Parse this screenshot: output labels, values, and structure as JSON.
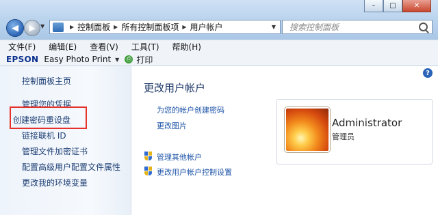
{
  "window": {
    "minimize_glyph": "–",
    "maximize_glyph": "□",
    "close_glyph": "✕"
  },
  "address_bar": {
    "breadcrumbs": [
      "控制面板",
      "所有控制面板项",
      "用户帐户"
    ],
    "search_placeholder": "搜索控制面板"
  },
  "menu": [
    "文件(F)",
    "编辑(E)",
    "查看(V)",
    "工具(T)",
    "帮助(H)"
  ],
  "epson_toolbar": {
    "brand": "EPSON",
    "app": "Easy Photo Print",
    "print": "打印"
  },
  "sidebar": {
    "items": [
      {
        "label": "控制面板主页"
      },
      {
        "label": "管理您的凭据"
      },
      {
        "label": "创建密码重设盘",
        "highlighted": true
      },
      {
        "label": "链接联机 ID"
      },
      {
        "label": "管理文件加密证书"
      },
      {
        "label": "配置高级用户配置文件属性"
      },
      {
        "label": "更改我的环境变量"
      }
    ]
  },
  "main": {
    "title": "更改用户帐户",
    "links": [
      "为您的帐户创建密码",
      "更改图片"
    ],
    "admin_links": [
      "管理其他帐户",
      "更改用户帐户控制设置"
    ]
  },
  "account": {
    "name": "Administrator",
    "role": "管理员"
  },
  "colors": {
    "highlight_border": "#e5322b",
    "link": "#1e54a8",
    "epson_brand": "#0a2f8c"
  },
  "icons": [
    "back-arrow-icon",
    "forward-arrow-icon",
    "folder-icon",
    "refresh-icon",
    "search-icon",
    "print-icon",
    "help-icon",
    "uac-shield-icon"
  ]
}
